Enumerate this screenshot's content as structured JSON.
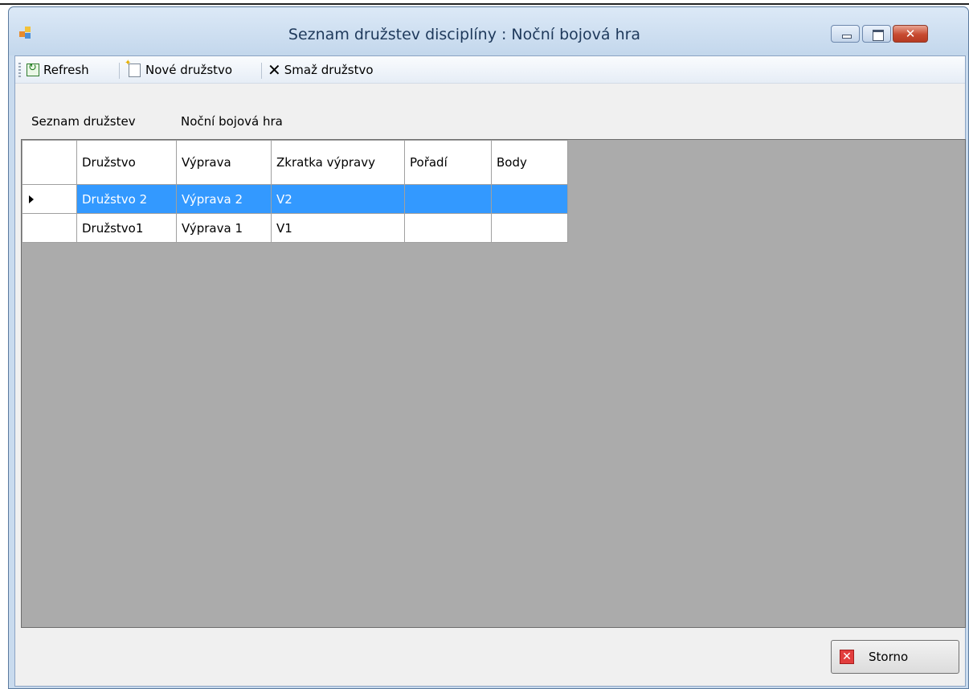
{
  "window": {
    "title": "Seznam družstev disciplíny : Noční bojová hra"
  },
  "toolbar": {
    "refresh_label": "Refresh",
    "new_label": "Nové družstvo",
    "delete_label": "Smaž družstvo"
  },
  "labels": {
    "list_label": "Seznam družstev",
    "discipline_name": "Noční bojová hra"
  },
  "grid": {
    "columns": [
      "Družstvo",
      "Výprava",
      "Zkratka výpravy",
      "Pořadí",
      "Body"
    ],
    "rows": [
      {
        "druzstvo": "Družstvo 2",
        "vyprava": "Výprava 2",
        "zkratka": "V2",
        "poradi": "",
        "body": "",
        "selected": true
      },
      {
        "druzstvo": "Družstvo1",
        "vyprava": "Výprava 1",
        "zkratka": "V1",
        "poradi": "",
        "body": "",
        "selected": false
      }
    ]
  },
  "footer": {
    "cancel_label": "Storno"
  },
  "colors": {
    "selection": "#3399ff",
    "grid_background": "#ababab"
  }
}
